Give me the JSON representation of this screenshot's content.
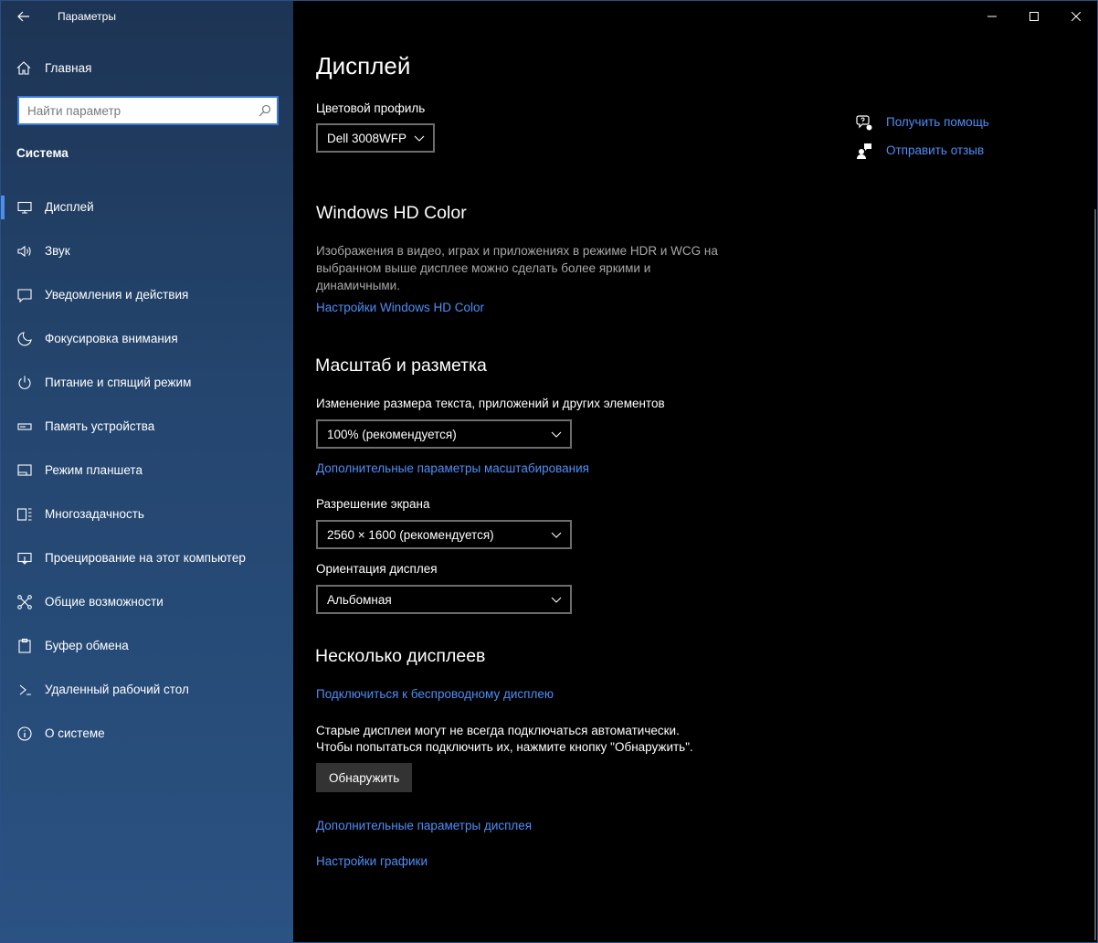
{
  "app": {
    "title": "Параметры"
  },
  "sidebar": {
    "home_label": "Главная",
    "search_placeholder": "Найти параметр",
    "section_title": "Система",
    "items": [
      {
        "label": "Дисплей",
        "icon": "monitor-icon",
        "active": true
      },
      {
        "label": "Звук",
        "icon": "speaker-icon"
      },
      {
        "label": "Уведомления и действия",
        "icon": "notification-icon"
      },
      {
        "label": "Фокусировка внимания",
        "icon": "moon-icon"
      },
      {
        "label": "Питание и спящий режим",
        "icon": "power-icon"
      },
      {
        "label": "Память устройства",
        "icon": "storage-icon"
      },
      {
        "label": "Режим планшета",
        "icon": "tablet-icon"
      },
      {
        "label": "Многозадачность",
        "icon": "multitask-icon"
      },
      {
        "label": "Проецирование на этот компьютер",
        "icon": "project-icon"
      },
      {
        "label": "Общие возможности",
        "icon": "shared-icon"
      },
      {
        "label": "Буфер обмена",
        "icon": "clipboard-icon"
      },
      {
        "label": "Удаленный рабочий стол",
        "icon": "remote-desktop-icon"
      },
      {
        "label": "О системе",
        "icon": "info-icon"
      }
    ]
  },
  "main": {
    "page_title": "Дисплей",
    "color_profile": {
      "label": "Цветовой профиль",
      "value": "Dell 3008WFP"
    },
    "hd_color": {
      "heading": "Windows HD Color",
      "desc": "Изображения в видео, играх и приложениях в режиме HDR и WCG на выбранном выше дисплее можно сделать более яркими и динамичными.",
      "link": "Настройки Windows HD Color"
    },
    "scale": {
      "heading": "Масштаб и разметка",
      "size_label": "Изменение размера текста, приложений и других элементов",
      "size_value": "100% (рекомендуется)",
      "advanced_link": "Дополнительные параметры масштабирования",
      "resolution_label": "Разрешение экрана",
      "resolution_value": "2560 × 1600 (рекомендуется)",
      "orientation_label": "Ориентация дисплея",
      "orientation_value": "Альбомная"
    },
    "multi": {
      "heading": "Несколько дисплеев",
      "wireless_link": "Подключиться к беспроводному дисплею",
      "text_line1": "Старые дисплеи могут не всегда подключаться автоматически.",
      "text_line2": "Чтобы попытаться подключить их, нажмите кнопку \"Обнаружить\".",
      "detect_button": "Обнаружить",
      "advanced_display_link": "Дополнительные параметры дисплея",
      "graphics_link": "Настройки графики"
    },
    "help": {
      "get_help": "Получить помощь",
      "feedback": "Отправить отзыв"
    }
  },
  "colors": {
    "accent": "#4e8ef5",
    "sidebar_top": "#1d3454",
    "sidebar_bottom": "#2a5282"
  }
}
